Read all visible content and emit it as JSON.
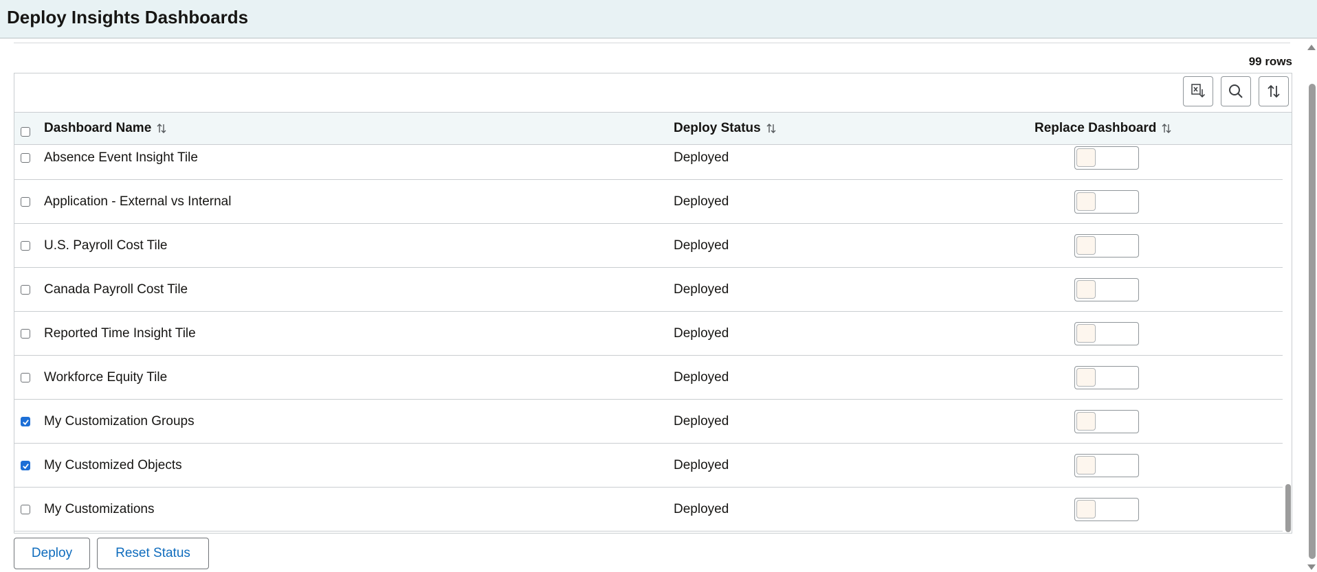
{
  "page": {
    "title": "Deploy Insights Dashboards"
  },
  "grid": {
    "row_count_label": "99 rows",
    "toolbar": {
      "export_label": "Export to Excel",
      "search_label": "Search",
      "sort_label": "Sort"
    },
    "columns": {
      "name": "Dashboard Name",
      "status": "Deploy Status",
      "replace": "Replace Dashboard"
    },
    "rows": [
      {
        "name": "Absence Event Insight Tile",
        "status": "Deployed",
        "selected": false,
        "replace": false
      },
      {
        "name": "Application - External vs Internal",
        "status": "Deployed",
        "selected": false,
        "replace": false
      },
      {
        "name": "U.S. Payroll Cost Tile",
        "status": "Deployed",
        "selected": false,
        "replace": false
      },
      {
        "name": "Canada Payroll Cost Tile",
        "status": "Deployed",
        "selected": false,
        "replace": false
      },
      {
        "name": "Reported Time Insight Tile",
        "status": "Deployed",
        "selected": false,
        "replace": false
      },
      {
        "name": "Workforce Equity Tile",
        "status": "Deployed",
        "selected": false,
        "replace": false
      },
      {
        "name": "My Customization Groups",
        "status": "Deployed",
        "selected": true,
        "replace": false
      },
      {
        "name": "My Customized Objects",
        "status": "Deployed",
        "selected": true,
        "replace": false
      },
      {
        "name": "My Customizations",
        "status": "Deployed",
        "selected": false,
        "replace": false
      }
    ]
  },
  "actions": {
    "deploy_label": "Deploy",
    "reset_label": "Reset Status"
  },
  "colors": {
    "header_bg": "#e8f2f4",
    "link": "#0f6cbd",
    "checkbox_checked": "#1d6fd6"
  }
}
